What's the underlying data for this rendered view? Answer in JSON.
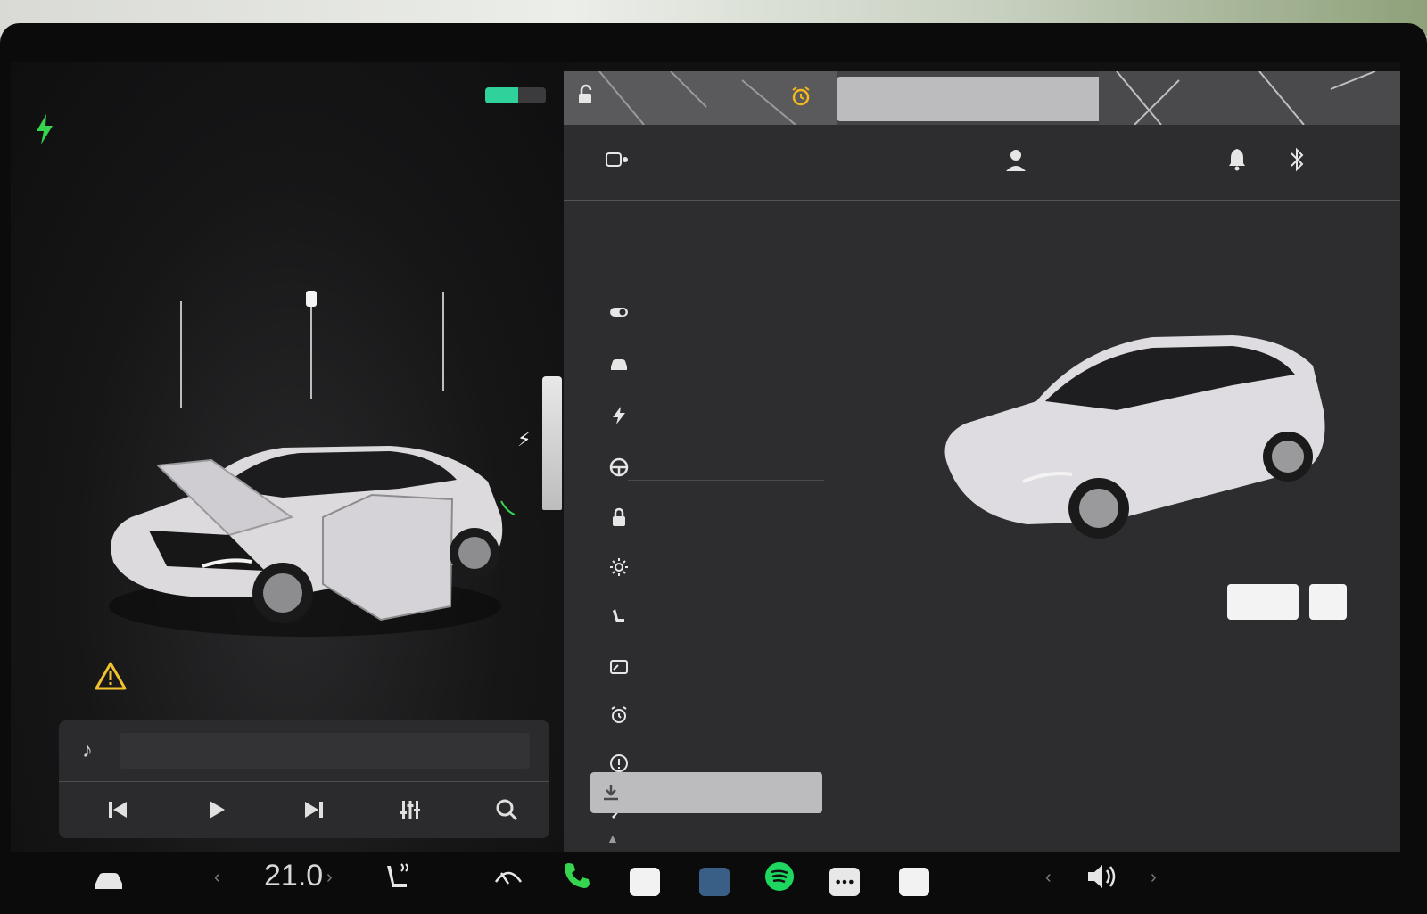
{
  "battery": {
    "level": 0.55,
    "color": "#2fd29a"
  },
  "accent": {
    "charge_green": "#36d54f",
    "warning_yellow": "#f2c230",
    "alarm_yellow": "#f3b91c"
  },
  "icons": {
    "charging": "lightning-bolt-icon",
    "warning": "warning-triangle-icon",
    "lock": "unlocked-padlock-icon",
    "alarm": "alarm-clock-icon",
    "bell": "bell-icon",
    "bluetooth": "bluetooth-icon"
  },
  "media": {
    "note_glyph": "♪",
    "controls": [
      "previous",
      "play",
      "next",
      "equalizer",
      "search"
    ]
  },
  "menu": {
    "items": [
      {
        "name": "controls",
        "icon": "toggle-icon"
      },
      {
        "name": "dynamics",
        "icon": "car-icon"
      },
      {
        "name": "charging",
        "icon": "lightning-bolt-icon"
      },
      {
        "name": "autopilot",
        "icon": "steering-wheel-icon"
      },
      {
        "name": "locks",
        "icon": "padlock-icon"
      },
      {
        "name": "lights",
        "icon": "sun-icon"
      },
      {
        "name": "display",
        "icon": "seat-icon"
      },
      {
        "name": "trips",
        "icon": "screen-icon"
      },
      {
        "name": "schedule",
        "icon": "alarm-clock-icon"
      },
      {
        "name": "safety",
        "icon": "info-circle-icon"
      },
      {
        "name": "service",
        "icon": "wrench-icon"
      },
      {
        "name": "software",
        "icon": "download-icon"
      }
    ],
    "caret_glyph": "▲"
  },
  "dock": {
    "temperature": "21.0",
    "left_chevron": "‹",
    "right_chevron": "›",
    "vol_left": "‹",
    "vol_right": "›"
  }
}
